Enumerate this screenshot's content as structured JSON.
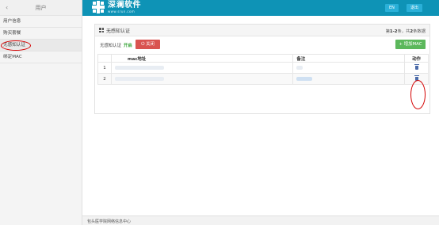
{
  "sidebar": {
    "title": "用户",
    "back_icon": "chevron-left-icon",
    "items": [
      {
        "label": "用户信息"
      },
      {
        "label": "购买套餐"
      },
      {
        "label": "无感知认证"
      },
      {
        "label": "绑定MAC"
      }
    ]
  },
  "header": {
    "logo_name": "深澜软件",
    "logo_url": "www.srun.com",
    "lang_button": "EN",
    "logout_button": "退出",
    "brand_color": "#0e93b6"
  },
  "panel": {
    "title": "无感知认证",
    "title_icon": "grid-icon",
    "count_prefix": "第",
    "count_range": "1-2",
    "count_mid": "条，共",
    "count_total": "2",
    "count_suffix": "条数据",
    "tool_label": "无感知认证",
    "tool_state": "开启",
    "close_button": "关闭",
    "add_button": "增加MAC"
  },
  "table": {
    "columns": {
      "idx": "",
      "mac": "mac地址",
      "note": "备注",
      "action": "动作"
    },
    "rows": [
      {
        "idx": "1",
        "action_icon": "trash-icon"
      },
      {
        "idx": "2",
        "action_icon": "trash-icon"
      }
    ]
  },
  "footer": {
    "text": "包头医学院网络信息中心"
  }
}
